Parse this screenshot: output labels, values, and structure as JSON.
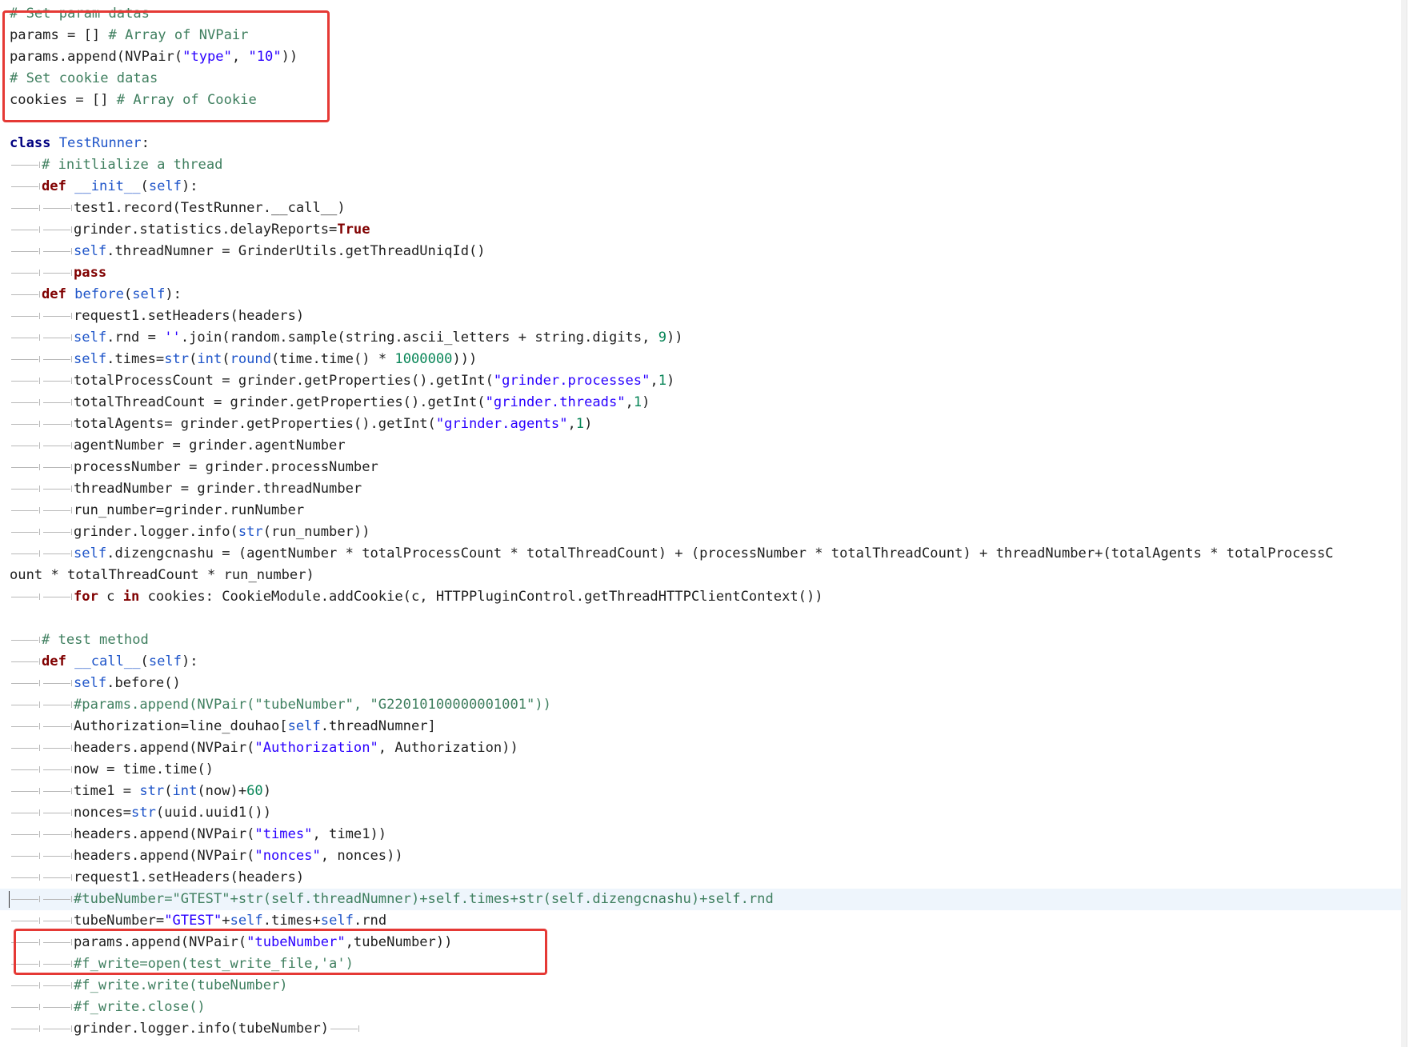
{
  "editor": {
    "lines": [
      {
        "indent": 0,
        "tokens": [
          {
            "t": "# Set param datas",
            "c": "c"
          }
        ]
      },
      {
        "indent": 0,
        "tokens": [
          {
            "t": "params = [] ",
            "c": ""
          },
          {
            "t": "# Array of NVPair",
            "c": "c"
          }
        ]
      },
      {
        "indent": 0,
        "tokens": [
          {
            "t": "params.append(NVPair(",
            "c": ""
          },
          {
            "t": "\"type\"",
            "c": "s"
          },
          {
            "t": ", ",
            "c": ""
          },
          {
            "t": "\"10\"",
            "c": "s"
          },
          {
            "t": "))",
            "c": ""
          }
        ]
      },
      {
        "indent": 0,
        "tokens": [
          {
            "t": "# Set cookie datas",
            "c": "c"
          }
        ]
      },
      {
        "indent": 0,
        "tokens": [
          {
            "t": "cookies = [] ",
            "c": ""
          },
          {
            "t": "# Array of Cookie",
            "c": "c"
          }
        ]
      },
      {
        "indent": 0,
        "blank": true,
        "tokens": []
      },
      {
        "indent": 0,
        "tokens": [
          {
            "t": "class ",
            "c": "kw"
          },
          {
            "t": "TestRunner",
            "c": "def"
          },
          {
            "t": ":",
            "c": ""
          }
        ]
      },
      {
        "indent": 1,
        "tokens": [
          {
            "t": "# initlialize a thread",
            "c": "c"
          }
        ]
      },
      {
        "indent": 1,
        "tokens": [
          {
            "t": "def ",
            "c": "k"
          },
          {
            "t": "__init__",
            "c": "def"
          },
          {
            "t": "(",
            "c": ""
          },
          {
            "t": "self",
            "c": "b"
          },
          {
            "t": "):",
            "c": ""
          }
        ]
      },
      {
        "indent": 2,
        "tokens": [
          {
            "t": "test1.record(TestRunner.__call__)",
            "c": ""
          }
        ]
      },
      {
        "indent": 2,
        "tokens": [
          {
            "t": "grinder.statistics.delayReports=",
            "c": ""
          },
          {
            "t": "True",
            "c": "k"
          }
        ]
      },
      {
        "indent": 2,
        "tokens": [
          {
            "t": "self",
            "c": "b"
          },
          {
            "t": ".threadNumner = GrinderUtils.getThreadUniqId()",
            "c": ""
          }
        ]
      },
      {
        "indent": 2,
        "tokens": [
          {
            "t": "pass",
            "c": "k"
          }
        ]
      },
      {
        "indent": 1,
        "tokens": [
          {
            "t": "def ",
            "c": "k"
          },
          {
            "t": "before",
            "c": "def"
          },
          {
            "t": "(",
            "c": ""
          },
          {
            "t": "self",
            "c": "b"
          },
          {
            "t": "):",
            "c": ""
          }
        ]
      },
      {
        "indent": 2,
        "tokens": [
          {
            "t": "request1.setHeaders(headers)",
            "c": ""
          }
        ]
      },
      {
        "indent": 2,
        "tokens": [
          {
            "t": "self",
            "c": "b"
          },
          {
            "t": ".rnd = ",
            "c": ""
          },
          {
            "t": "''",
            "c": "s"
          },
          {
            "t": ".join(random.sample(string.ascii_letters + string.digits, ",
            "c": ""
          },
          {
            "t": "9",
            "c": "num"
          },
          {
            "t": "))",
            "c": ""
          }
        ]
      },
      {
        "indent": 2,
        "tokens": [
          {
            "t": "self",
            "c": "b"
          },
          {
            "t": ".times=",
            "c": ""
          },
          {
            "t": "str",
            "c": "b"
          },
          {
            "t": "(",
            "c": ""
          },
          {
            "t": "int",
            "c": "b"
          },
          {
            "t": "(",
            "c": ""
          },
          {
            "t": "round",
            "c": "b"
          },
          {
            "t": "(time.time() * ",
            "c": ""
          },
          {
            "t": "1000000",
            "c": "num"
          },
          {
            "t": ")))",
            "c": ""
          }
        ]
      },
      {
        "indent": 2,
        "tokens": [
          {
            "t": "totalProcessCount = grinder.getProperties().getInt(",
            "c": ""
          },
          {
            "t": "\"grinder.processes\"",
            "c": "s"
          },
          {
            "t": ",",
            "c": ""
          },
          {
            "t": "1",
            "c": "num"
          },
          {
            "t": ")",
            "c": ""
          }
        ]
      },
      {
        "indent": 2,
        "tokens": [
          {
            "t": "totalThreadCount = grinder.getProperties().getInt(",
            "c": ""
          },
          {
            "t": "\"grinder.threads\"",
            "c": "s"
          },
          {
            "t": ",",
            "c": ""
          },
          {
            "t": "1",
            "c": "num"
          },
          {
            "t": ")",
            "c": ""
          }
        ]
      },
      {
        "indent": 2,
        "tokens": [
          {
            "t": "totalAgents= grinder.getProperties().getInt(",
            "c": ""
          },
          {
            "t": "\"grinder.agents\"",
            "c": "s"
          },
          {
            "t": ",",
            "c": ""
          },
          {
            "t": "1",
            "c": "num"
          },
          {
            "t": ")",
            "c": ""
          }
        ]
      },
      {
        "indent": 2,
        "tokens": [
          {
            "t": "agentNumber = grinder.agentNumber",
            "c": ""
          }
        ]
      },
      {
        "indent": 2,
        "tokens": [
          {
            "t": "processNumber = grinder.processNumber",
            "c": ""
          }
        ]
      },
      {
        "indent": 2,
        "tokens": [
          {
            "t": "threadNumber = grinder.threadNumber",
            "c": ""
          }
        ]
      },
      {
        "indent": 2,
        "tokens": [
          {
            "t": "run_number=grinder.runNumber",
            "c": ""
          }
        ]
      },
      {
        "indent": 2,
        "tokens": [
          {
            "t": "grinder.logger.info(",
            "c": ""
          },
          {
            "t": "str",
            "c": "b"
          },
          {
            "t": "(run_number))",
            "c": ""
          }
        ]
      },
      {
        "indent": 2,
        "wrapped": true,
        "tokens": [
          {
            "t": "self",
            "c": "b"
          },
          {
            "t": ".dizengcnashu = (agentNumber * totalProcessCount * totalThreadCount) + (processNumber * totalThreadCount) + threadNumber+(totalAgents * totalProcessCount * totalThreadCount * run_number)",
            "c": ""
          }
        ]
      },
      {
        "indent": 2,
        "tokens": [
          {
            "t": "for",
            "c": "k"
          },
          {
            "t": " c ",
            "c": ""
          },
          {
            "t": "in",
            "c": "k"
          },
          {
            "t": " cookies: CookieModule.addCookie(c, HTTPPluginControl.getThreadHTTPClientContext())",
            "c": ""
          }
        ]
      },
      {
        "indent": 0,
        "blank": true,
        "tokens": []
      },
      {
        "indent": 1,
        "tokens": [
          {
            "t": "# test method",
            "c": "c"
          }
        ]
      },
      {
        "indent": 1,
        "tokens": [
          {
            "t": "def ",
            "c": "k"
          },
          {
            "t": "__call__",
            "c": "def"
          },
          {
            "t": "(",
            "c": ""
          },
          {
            "t": "self",
            "c": "b"
          },
          {
            "t": "):",
            "c": ""
          }
        ]
      },
      {
        "indent": 2,
        "tokens": [
          {
            "t": "self",
            "c": "b"
          },
          {
            "t": ".before()",
            "c": ""
          }
        ]
      },
      {
        "indent": 2,
        "tokens": [
          {
            "t": "#params.append(NVPair(\"tubeNumber\", \"G22010100000001001\"))",
            "c": "c"
          }
        ]
      },
      {
        "indent": 2,
        "tokens": [
          {
            "t": "Authorization=line_douhao[",
            "c": ""
          },
          {
            "t": "self",
            "c": "b"
          },
          {
            "t": ".threadNumner]",
            "c": ""
          }
        ]
      },
      {
        "indent": 2,
        "tokens": [
          {
            "t": "headers.append(NVPair(",
            "c": ""
          },
          {
            "t": "\"Authorization\"",
            "c": "s"
          },
          {
            "t": ", Authorization))",
            "c": ""
          }
        ]
      },
      {
        "indent": 2,
        "tokens": [
          {
            "t": "now = time.time()",
            "c": ""
          }
        ]
      },
      {
        "indent": 2,
        "tokens": [
          {
            "t": "time1 = ",
            "c": ""
          },
          {
            "t": "str",
            "c": "b"
          },
          {
            "t": "(",
            "c": ""
          },
          {
            "t": "int",
            "c": "b"
          },
          {
            "t": "(now)+",
            "c": ""
          },
          {
            "t": "60",
            "c": "num"
          },
          {
            "t": ")",
            "c": ""
          }
        ]
      },
      {
        "indent": 2,
        "tokens": [
          {
            "t": "nonces=",
            "c": ""
          },
          {
            "t": "str",
            "c": "b"
          },
          {
            "t": "(uuid.uuid1())",
            "c": ""
          }
        ]
      },
      {
        "indent": 2,
        "tokens": [
          {
            "t": "headers.append(NVPair(",
            "c": ""
          },
          {
            "t": "\"times\"",
            "c": "s"
          },
          {
            "t": ", time1))",
            "c": ""
          }
        ]
      },
      {
        "indent": 2,
        "tokens": [
          {
            "t": "headers.append(NVPair(",
            "c": ""
          },
          {
            "t": "\"nonces\"",
            "c": "s"
          },
          {
            "t": ", nonces))",
            "c": ""
          }
        ]
      },
      {
        "indent": 2,
        "tokens": [
          {
            "t": "request1.setHeaders(headers)",
            "c": ""
          }
        ]
      },
      {
        "indent": 2,
        "highlight": true,
        "tokens": [
          {
            "t": "#tubeNumber=\"GTEST\"+str(self.threadNumner)+self.times+str(self.dizengcnashu)+self.rnd",
            "c": "c"
          }
        ]
      },
      {
        "indent": 2,
        "tokens": [
          {
            "t": "tubeNumber=",
            "c": ""
          },
          {
            "t": "\"GTEST\"",
            "c": "s"
          },
          {
            "t": "+",
            "c": ""
          },
          {
            "t": "self",
            "c": "b"
          },
          {
            "t": ".times+",
            "c": ""
          },
          {
            "t": "self",
            "c": "b"
          },
          {
            "t": ".rnd",
            "c": ""
          }
        ]
      },
      {
        "indent": 2,
        "tokens": [
          {
            "t": "params.append(NVPair(",
            "c": ""
          },
          {
            "t": "\"tubeNumber\"",
            "c": "s"
          },
          {
            "t": ",tubeNumber))",
            "c": ""
          }
        ]
      },
      {
        "indent": 2,
        "tokens": [
          {
            "t": "#f_write=open(test_write_file,'a')",
            "c": "c"
          }
        ]
      },
      {
        "indent": 2,
        "tokens": [
          {
            "t": "#f_write.write(tubeNumber)",
            "c": "c"
          }
        ]
      },
      {
        "indent": 2,
        "tokens": [
          {
            "t": "#f_write.close()",
            "c": "c"
          }
        ]
      },
      {
        "indent": 2,
        "trailingTab": true,
        "tokens": [
          {
            "t": "grinder.logger.info(tubeNumber)",
            "c": ""
          }
        ]
      }
    ]
  },
  "annotations": [
    {
      "name": "highlight-box-params-cookies",
      "color": "#e53935"
    },
    {
      "name": "highlight-box-append-tubenumber",
      "color": "#e53935"
    }
  ]
}
